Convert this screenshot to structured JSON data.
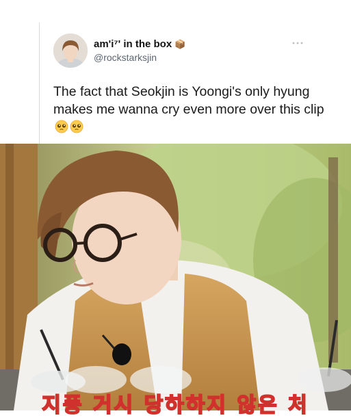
{
  "tweet": {
    "display_name": "am'i⁷' in the box",
    "name_badge_icon": "box-emoji-icon",
    "handle": "@rockstarksjin",
    "more_icon": "more-options-icon",
    "text": "The fact that Seokjin is Yoongi's only hyung makes me wanna cry even more over this clip",
    "emojis": [
      "pleading-face-icon",
      "pleading-face-icon"
    ]
  },
  "media": {
    "description_icon": "video-still",
    "subtitle": "지풍 거시 당하하지 않은 처"
  },
  "colors": {
    "handle": "#5b6670",
    "text": "#1a1a1a",
    "subtitle_fill": "#ffde2a",
    "subtitle_stroke": "#d0312d"
  }
}
